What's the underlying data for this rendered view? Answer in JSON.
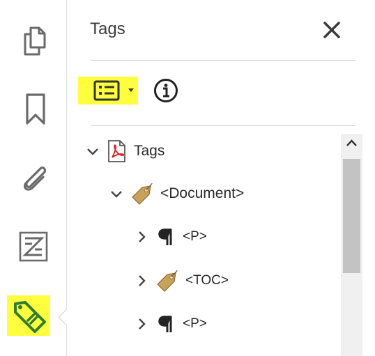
{
  "rail": {
    "items": [
      {
        "name": "pages-icon"
      },
      {
        "name": "bookmark-icon"
      },
      {
        "name": "attachment-icon"
      },
      {
        "name": "layers-icon"
      },
      {
        "name": "tag-icon",
        "active": true
      }
    ],
    "highlight_color": "#ffff3d"
  },
  "panel": {
    "title": "Tags",
    "close_icon": "close-icon",
    "options_icon": "options-menu-icon",
    "info_icon": "info-icon"
  },
  "tree": {
    "root": {
      "label": "Tags",
      "icon": "pdf-icon",
      "expanded": true
    },
    "document": {
      "label": "<Document>",
      "icon": "tag-icon",
      "expanded": true
    },
    "children": [
      {
        "label": "<P>",
        "icon": "paragraph-icon",
        "expanded": false
      },
      {
        "label": "<TOC>",
        "icon": "tag-icon",
        "expanded": false
      },
      {
        "label": "<P>",
        "icon": "paragraph-icon",
        "expanded": false
      }
    ]
  }
}
